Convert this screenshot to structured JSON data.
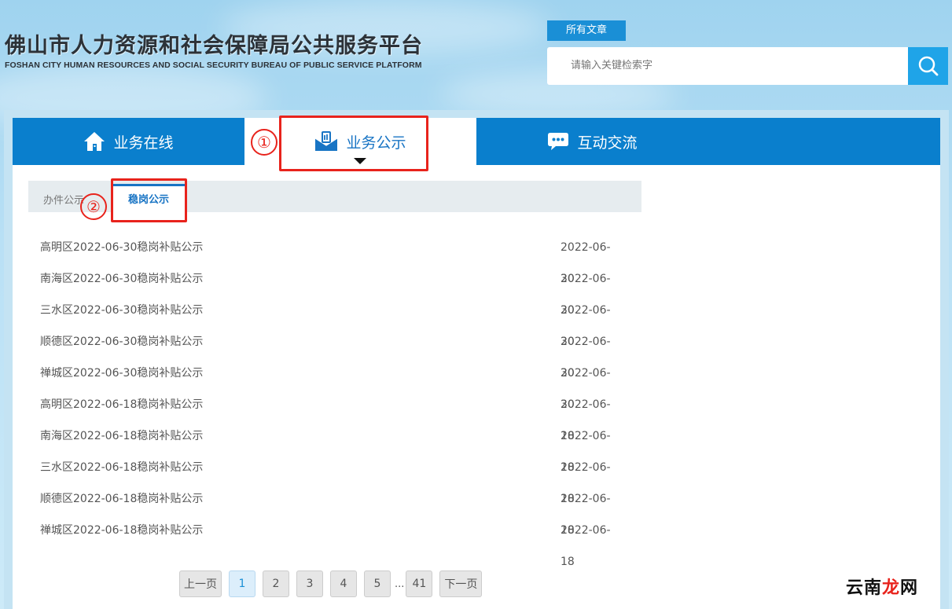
{
  "header": {
    "title_cn": "佛山市人力资源和社会保障局公共服务平台",
    "title_en": "FOSHAN CITY HUMAN RESOURCES AND SOCIAL SECURITY BUREAU OF PUBLIC SERVICE PLATFORM",
    "search_tag": "所有文章",
    "search_placeholder": "请输入关键检索字"
  },
  "nav": {
    "items": [
      {
        "label": "业务在线",
        "icon": "home-icon"
      },
      {
        "label": "业务公示",
        "icon": "envelope-icon",
        "active": true
      },
      {
        "label": "互动交流",
        "icon": "chat-bubble-icon"
      }
    ]
  },
  "annotations": {
    "marker1": "①",
    "marker2": "②",
    "color": "#e8231c"
  },
  "subtabs": {
    "inactive": "办件公示",
    "active": "稳岗公示"
  },
  "list": [
    {
      "title": "高明区2022-06-30稳岗补贴公示",
      "date": "2022-06-30"
    },
    {
      "title": "南海区2022-06-30稳岗补贴公示",
      "date": "2022-06-30"
    },
    {
      "title": "三水区2022-06-30稳岗补贴公示",
      "date": "2022-06-30"
    },
    {
      "title": "顺德区2022-06-30稳岗补贴公示",
      "date": "2022-06-30"
    },
    {
      "title": "禅城区2022-06-30稳岗补贴公示",
      "date": "2022-06-30"
    },
    {
      "title": "高明区2022-06-18稳岗补贴公示",
      "date": "2022-06-18"
    },
    {
      "title": "南海区2022-06-18稳岗补贴公示",
      "date": "2022-06-18"
    },
    {
      "title": "三水区2022-06-18稳岗补贴公示",
      "date": "2022-06-18"
    },
    {
      "title": "顺德区2022-06-18稳岗补贴公示",
      "date": "2022-06-18"
    },
    {
      "title": "禅城区2022-06-18稳岗补贴公示",
      "date": "2022-06-18"
    }
  ],
  "pager": {
    "prev": "上一页",
    "pages": [
      "1",
      "2",
      "3",
      "4",
      "5"
    ],
    "ellipsis": "...",
    "last": "41",
    "next": "下一页",
    "current": "1"
  },
  "watermark": {
    "left": "云南",
    "mid": "龙",
    "right": "网"
  },
  "colors": {
    "nav_blue": "#0a7fcd",
    "accent": "#1874c4",
    "search_btn": "#1fa4e8",
    "marker_red": "#e8231c"
  }
}
